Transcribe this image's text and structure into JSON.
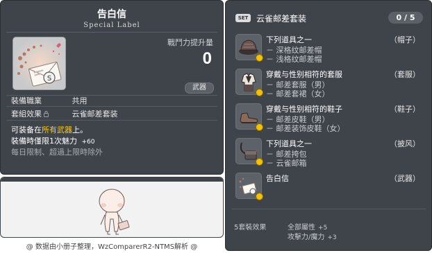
{
  "corner_id": "01703806",
  "item": {
    "name": "告白信",
    "subtitle": "Special Label",
    "power_label": "戰鬥力提升量",
    "power_value": "0",
    "category": "武器",
    "job_label": "裝備職業",
    "job_value": "共用",
    "set_label": "套組效果",
    "set_value": "云雀邮差套装",
    "desc_prefix": "可装备在",
    "desc_highlight": "所有武器",
    "desc_suffix": "上。",
    "charm_text": "裝備時僅限1次魅力",
    "charm_value": "+60",
    "note": "每日限制、超過上限時除外"
  },
  "credit": "@ 数据由小册子整理，WzComparerR2-NTMS解析 @",
  "set": {
    "badge": "SET",
    "name": "云雀邮差套装",
    "count": "0 / 5",
    "entries": [
      {
        "name": "下列道具之一",
        "type": "（帽子）",
        "subs": [
          "－ 深格纹邮差帽",
          "－ 浅格纹邮差帽"
        ],
        "icon": "hat-icon"
      },
      {
        "name": "穿戴与性别相符的套服",
        "type": "（套服）",
        "subs": [
          "－ 邮差套服（男）",
          "－ 邮差套裙（女）"
        ],
        "icon": "outfit-icon"
      },
      {
        "name": "穿戴与性别相符的鞋子",
        "type": "（鞋子）",
        "subs": [
          "－ 邮差皮鞋（男）",
          "－ 邮差装饰皮鞋（女）"
        ],
        "icon": "shoes-icon"
      },
      {
        "name": "下列道具之一",
        "type": "（披风）",
        "subs": [
          "－ 邮差挎包",
          "－ 云雀邮箱"
        ],
        "icon": "bag-icon"
      },
      {
        "name": "告白信",
        "type": "（武器）",
        "subs": [],
        "icon": "letter-icon"
      }
    ],
    "bonus_label": "5套裝效果",
    "bonus_lines": [
      {
        "text": "全部屬性",
        "value": "+5"
      },
      {
        "text": "攻擊力/魔力",
        "value": "+3"
      }
    ]
  }
}
